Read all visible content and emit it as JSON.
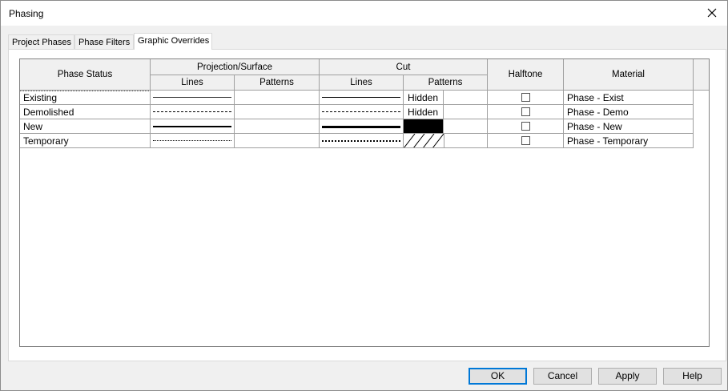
{
  "window": {
    "title": "Phasing"
  },
  "tabs": [
    {
      "label": "Project Phases"
    },
    {
      "label": "Phase Filters"
    },
    {
      "label": "Graphic Overrides"
    }
  ],
  "grid": {
    "headers": {
      "phase_status": "Phase Status",
      "projection_surface": "Projection/Surface",
      "cut": "Cut",
      "halftone": "Halftone",
      "material": "Material",
      "proj_lines": "Lines",
      "proj_patterns": "Patterns",
      "cut_lines": "Lines",
      "cut_patterns": "Patterns"
    },
    "rows": [
      {
        "status": "Existing",
        "proj_line": "thin-solid",
        "cut_line": "solid",
        "cut_pattern": "Hidden",
        "halftone": false,
        "material": "Phase - Exist"
      },
      {
        "status": "Demolished",
        "proj_line": "dashed",
        "cut_line": "dashed-heavy",
        "cut_pattern": "Hidden",
        "halftone": false,
        "material": "Phase - Demo"
      },
      {
        "status": "New",
        "proj_line": "thick-solid",
        "cut_line": "thick-solid",
        "cut_pattern": "solid-fill",
        "halftone": false,
        "material": "Phase - New"
      },
      {
        "status": "Temporary",
        "proj_line": "dotted",
        "cut_line": "dash-dot-heavy",
        "cut_pattern": "diagonal-hatch",
        "halftone": false,
        "material": "Phase - Temporary"
      }
    ]
  },
  "buttons": {
    "ok": "OK",
    "cancel": "Cancel",
    "apply": "Apply",
    "help": "Help"
  },
  "colors": {
    "accent": "#0078d7",
    "solid_fill": "#000000"
  }
}
